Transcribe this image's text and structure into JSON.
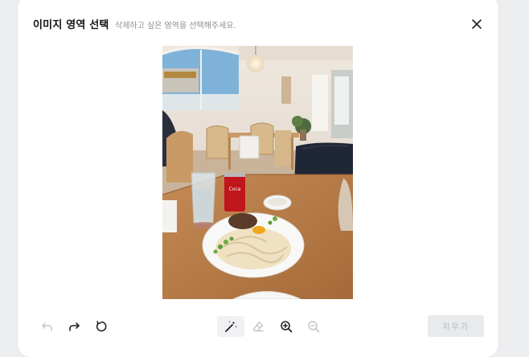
{
  "dialog": {
    "title": "이미지 영역 선택",
    "subtitle": "삭제하고 싶은 영역을 선택해주세요."
  },
  "photo": {
    "icon": "cafe-food-photo"
  },
  "toolbar": {
    "undo_icon": "undo-icon",
    "redo_icon": "redo-icon",
    "reset_icon": "reset-icon",
    "magic_wand_icon": "magic-wand-icon",
    "eraser_icon": "eraser-icon",
    "zoom_in_icon": "zoom-in-icon",
    "zoom_out_icon": "zoom-out-icon",
    "erase_label": "지우기"
  },
  "colors": {
    "accent_disabled": "#e9eaec",
    "text_primary": "#111111",
    "text_secondary": "#8b8f95"
  }
}
